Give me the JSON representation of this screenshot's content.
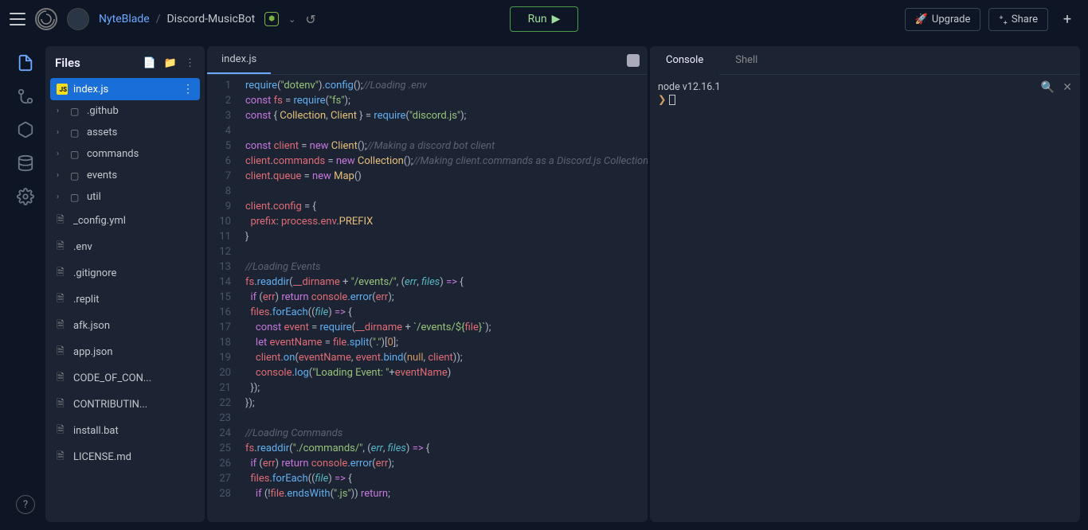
{
  "header": {
    "user": "NyteBlade",
    "repo": "Discord-MusicBot",
    "run_label": "Run",
    "upgrade_label": "Upgrade",
    "share_label": "Share"
  },
  "files": {
    "title": "Files",
    "items": [
      {
        "name": "index.js",
        "type": "js",
        "active": true
      },
      {
        "name": ".github",
        "type": "folder"
      },
      {
        "name": "assets",
        "type": "folder"
      },
      {
        "name": "commands",
        "type": "folder"
      },
      {
        "name": "events",
        "type": "folder"
      },
      {
        "name": "util",
        "type": "folder"
      },
      {
        "name": "_config.yml",
        "type": "file"
      },
      {
        "name": ".env",
        "type": "file"
      },
      {
        "name": ".gitignore",
        "type": "file"
      },
      {
        "name": ".replit",
        "type": "file"
      },
      {
        "name": "afk.json",
        "type": "file"
      },
      {
        "name": "app.json",
        "type": "file"
      },
      {
        "name": "CODE_OF_CON...",
        "type": "file"
      },
      {
        "name": "CONTRIBUTIN...",
        "type": "file"
      },
      {
        "name": "install.bat",
        "type": "file"
      },
      {
        "name": "LICENSE.md",
        "type": "file"
      }
    ]
  },
  "editor": {
    "tab": "index.js",
    "lines": [
      {
        "n": 1,
        "h": "<span class='f'>require</span><span class='p'>(</span><span class='s'>\"dotenv\"</span><span class='p'>).</span><span class='f'>config</span><span class='p'>();</span><span class='c'>//Loading .env</span>"
      },
      {
        "n": 2,
        "h": "<span class='k'>const</span> <span class='v'>fs</span> <span class='p'>=</span> <span class='f'>require</span><span class='p'>(</span><span class='s'>\"fs\"</span><span class='p'>);</span>"
      },
      {
        "n": 3,
        "h": "<span class='k'>const</span> <span class='p'>{</span> <span class='e'>Collection</span><span class='p'>,</span> <span class='e'>Client</span> <span class='p'>} =</span> <span class='f'>require</span><span class='p'>(</span><span class='s'>\"discord.js\"</span><span class='p'>);</span>"
      },
      {
        "n": 4,
        "h": ""
      },
      {
        "n": 5,
        "h": "<span class='k'>const</span> <span class='v'>client</span> <span class='p'>=</span> <span class='k'>new</span> <span class='e'>Client</span><span class='p'>();</span><span class='c'>//Making a discord bot client</span>"
      },
      {
        "n": 6,
        "h": "<span class='v'>client</span><span class='p'>.</span><span class='v'>commands</span> <span class='p'>=</span> <span class='k'>new</span> <span class='e'>Collection</span><span class='p'>();</span><span class='c'>//Making client.commands as a Discord.js Collection</span>"
      },
      {
        "n": 7,
        "h": "<span class='v'>client</span><span class='p'>.</span><span class='v'>queue</span> <span class='p'>=</span> <span class='k'>new</span> <span class='e'>Map</span><span class='p'>()</span>"
      },
      {
        "n": 8,
        "h": ""
      },
      {
        "n": 9,
        "h": "<span class='v'>client</span><span class='p'>.</span><span class='v'>config</span> <span class='p'>= {</span>"
      },
      {
        "n": 10,
        "h": "  <span class='v'>prefix</span><span class='p'>:</span> <span class='v'>process</span><span class='p'>.</span><span class='v'>env</span><span class='p'>.</span><span class='e'>PREFIX</span>"
      },
      {
        "n": 11,
        "h": "<span class='p'>}</span>"
      },
      {
        "n": 12,
        "h": ""
      },
      {
        "n": 13,
        "h": "<span class='c'>//Loading Events</span>"
      },
      {
        "n": 14,
        "h": "<span class='v'>fs</span><span class='p'>.</span><span class='f'>readdir</span><span class='p'>(</span><span class='v'>__dirname</span> <span class='p'>+</span> <span class='s'>\"/events/\"</span><span class='p'>, (</span><span class='i'>err</span><span class='p'>,</span> <span class='i'>files</span><span class='p'>)</span> <span class='k'>=&gt;</span> <span class='p'>{</span>"
      },
      {
        "n": 15,
        "h": "  <span class='k'>if</span> <span class='p'>(</span><span class='v'>err</span><span class='p'>)</span> <span class='k'>return</span> <span class='v'>console</span><span class='p'>.</span><span class='f'>error</span><span class='p'>(</span><span class='v'>err</span><span class='p'>);</span>"
      },
      {
        "n": 16,
        "h": "  <span class='v'>files</span><span class='p'>.</span><span class='f'>forEach</span><span class='p'>((</span><span class='i'>file</span><span class='p'>)</span> <span class='k'>=&gt;</span> <span class='p'>{</span>"
      },
      {
        "n": 17,
        "h": "    <span class='k'>const</span> <span class='v'>event</span> <span class='p'>=</span> <span class='f'>require</span><span class='p'>(</span><span class='v'>__dirname</span> <span class='p'>+</span> <span class='s'>`/events/${</span><span class='v'>file</span><span class='s'>}`</span><span class='p'>);</span>"
      },
      {
        "n": 18,
        "h": "    <span class='k'>let</span> <span class='v'>eventName</span> <span class='p'>=</span> <span class='v'>file</span><span class='p'>.</span><span class='f'>split</span><span class='p'>(</span><span class='s'>\".\"</span><span class='p'>)[</span><span class='n'>0</span><span class='p'>];</span>"
      },
      {
        "n": 19,
        "h": "    <span class='v'>client</span><span class='p'>.</span><span class='f'>on</span><span class='p'>(</span><span class='v'>eventName</span><span class='p'>,</span> <span class='v'>event</span><span class='p'>.</span><span class='f'>bind</span><span class='p'>(</span><span class='n'>null</span><span class='p'>,</span> <span class='v'>client</span><span class='p'>));</span>"
      },
      {
        "n": 20,
        "h": "    <span class='v'>console</span><span class='p'>.</span><span class='f'>log</span><span class='p'>(</span><span class='s'>\"Loading Event: \"</span><span class='p'>+</span><span class='v'>eventName</span><span class='p'>)</span>"
      },
      {
        "n": 21,
        "h": "  <span class='p'>});</span>"
      },
      {
        "n": 22,
        "h": "<span class='p'>});</span>"
      },
      {
        "n": 23,
        "h": ""
      },
      {
        "n": 24,
        "h": "<span class='c'>//Loading Commands</span>"
      },
      {
        "n": 25,
        "h": "<span class='v'>fs</span><span class='p'>.</span><span class='f'>readdir</span><span class='p'>(</span><span class='s'>\"./commands/\"</span><span class='p'>, (</span><span class='i'>err</span><span class='p'>,</span> <span class='i'>files</span><span class='p'>)</span> <span class='k'>=&gt;</span> <span class='p'>{</span>"
      },
      {
        "n": 26,
        "h": "  <span class='k'>if</span> <span class='p'>(</span><span class='v'>err</span><span class='p'>)</span> <span class='k'>return</span> <span class='v'>console</span><span class='p'>.</span><span class='f'>error</span><span class='p'>(</span><span class='v'>err</span><span class='p'>);</span>"
      },
      {
        "n": 27,
        "h": "  <span class='v'>files</span><span class='p'>.</span><span class='f'>forEach</span><span class='p'>((</span><span class='i'>file</span><span class='p'>)</span> <span class='k'>=&gt;</span> <span class='p'>{</span>"
      },
      {
        "n": 28,
        "h": "    <span class='k'>if</span> <span class='p'>(!</span><span class='v'>file</span><span class='p'>.</span><span class='f'>endsWith</span><span class='p'>(</span><span class='s'>\".js\"</span><span class='p'>))</span> <span class='k'>return</span><span class='p'>;</span>"
      }
    ]
  },
  "console": {
    "tabs": {
      "console": "Console",
      "shell": "Shell"
    },
    "output": "node v12.16.1"
  }
}
